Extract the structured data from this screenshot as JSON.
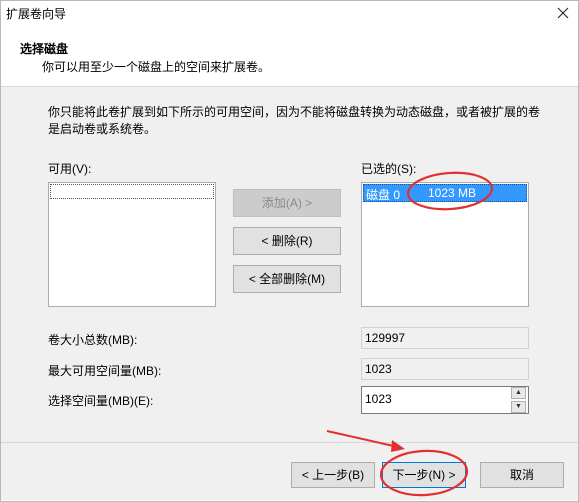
{
  "window": {
    "title": "扩展卷向导",
    "close_glyph": "✕"
  },
  "header": {
    "title": "选择磁盘",
    "subtitle": "你可以用至少一个磁盘上的空间来扩展卷。"
  },
  "main": {
    "description": "你只能将此卷扩展到如下所示的可用空间，因为不能将磁盘转换为动态磁盘，或者被扩展的卷是启动卷或系统卷。",
    "available_label": "可用(V):",
    "available_items": [],
    "selected_label": "已选的(S):",
    "selected_items": [
      {
        "disk": "磁盘 0",
        "size": "1023 MB"
      }
    ],
    "add_button": "添加(A) >",
    "remove_button": "< 删除(R)",
    "remove_all_button": "< 全部删除(M)",
    "total_size_label": "卷大小总数(MB):",
    "total_size_value": "129997",
    "max_space_label": "最大可用空间量(MB):",
    "max_space_value": "1023",
    "select_space_label": "选择空间量(MB)(E):",
    "select_space_value": "1023"
  },
  "footer": {
    "back_button": "< 上一步(B)",
    "next_button": "下一步(N) >",
    "cancel_button": "取消"
  },
  "annotations": {
    "color": "#e03030"
  },
  "colors": {
    "selection": "#3399ff",
    "primary_border": "#0078d7"
  }
}
